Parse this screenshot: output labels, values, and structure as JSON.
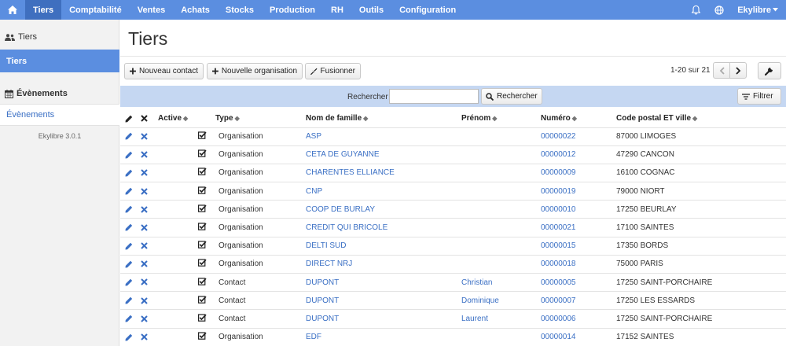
{
  "nav": {
    "items": [
      "Tiers",
      "Comptabilité",
      "Ventes",
      "Achats",
      "Stocks",
      "Production",
      "RH",
      "Outils",
      "Configuration"
    ],
    "active_index": 0,
    "user": "Ekylibre"
  },
  "sidebar": {
    "section1": "Tiers",
    "section1_item": "Tiers",
    "section2": "Évènements",
    "section2_item": "Évènements",
    "version": "Ekylibre 3.0.1"
  },
  "page": {
    "title": "Tiers",
    "new_contact": "Nouveau contact",
    "new_org": "Nouvelle organisation",
    "merge": "Fusionner",
    "pager": "1-20 sur 21"
  },
  "search": {
    "label": "Rechercher",
    "value": "",
    "button": "Rechercher",
    "filter": "Filtrer"
  },
  "table": {
    "headers": {
      "active": "Active",
      "type": "Type",
      "nom": "Nom de famille",
      "prenom": "Prénom",
      "numero": "Numéro",
      "cp": "Code postal ET ville"
    },
    "rows": [
      {
        "type": "Organisation",
        "nom": "ASP",
        "prenom": "",
        "numero": "00000022",
        "cp": "87000 LIMOGES"
      },
      {
        "type": "Organisation",
        "nom": "CETA DE GUYANNE",
        "prenom": "",
        "numero": "00000012",
        "cp": "47290 CANCON"
      },
      {
        "type": "Organisation",
        "nom": "CHARENTES ELLIANCE",
        "prenom": "",
        "numero": "00000009",
        "cp": "16100 COGNAC"
      },
      {
        "type": "Organisation",
        "nom": "CNP",
        "prenom": "",
        "numero": "00000019",
        "cp": "79000 NIORT"
      },
      {
        "type": "Organisation",
        "nom": "COOP DE BURLAY",
        "prenom": "",
        "numero": "00000010",
        "cp": "17250 BEURLAY"
      },
      {
        "type": "Organisation",
        "nom": "CREDIT QUI BRICOLE",
        "prenom": "",
        "numero": "00000021",
        "cp": "17100 SAINTES"
      },
      {
        "type": "Organisation",
        "nom": "DELTI SUD",
        "prenom": "",
        "numero": "00000015",
        "cp": "17350 BORDS"
      },
      {
        "type": "Organisation",
        "nom": "DIRECT NRJ",
        "prenom": "",
        "numero": "00000018",
        "cp": "75000 PARIS"
      },
      {
        "type": "Contact",
        "nom": "DUPONT",
        "prenom": "Christian",
        "numero": "00000005",
        "cp": "17250 SAINT-PORCHAIRE"
      },
      {
        "type": "Contact",
        "nom": "DUPONT",
        "prenom": "Dominique",
        "numero": "00000007",
        "cp": "17250 LES ESSARDS"
      },
      {
        "type": "Contact",
        "nom": "DUPONT",
        "prenom": "Laurent",
        "numero": "00000006",
        "cp": "17250 SAINT-PORCHAIRE"
      },
      {
        "type": "Organisation",
        "nom": "EDF",
        "prenom": "",
        "numero": "00000014",
        "cp": "17152 SAINTES"
      }
    ]
  },
  "colors": {
    "nav": "#5b8ee0",
    "nav_active": "#3f6fbf",
    "link": "#3a6fc4",
    "searchbar": "#c5d7f2"
  },
  "icons": {
    "home": "home-icon",
    "bell": "bell-icon",
    "globe": "globe-icon",
    "edit": "pencil-icon",
    "delete": "cross-icon",
    "checked": "checkbox-checked-icon"
  }
}
